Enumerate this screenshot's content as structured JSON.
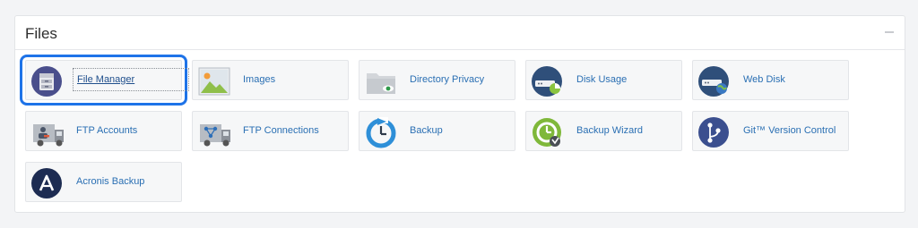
{
  "section": {
    "title": "Files",
    "collapse_icon": "minus-icon"
  },
  "items": [
    {
      "label": "File Manager",
      "icon": "file-manager-icon",
      "selected": true
    },
    {
      "label": "Images",
      "icon": "images-icon"
    },
    {
      "label": "Directory Privacy",
      "icon": "directory-privacy-icon"
    },
    {
      "label": "Disk Usage",
      "icon": "disk-usage-icon"
    },
    {
      "label": "Web Disk",
      "icon": "web-disk-icon"
    },
    {
      "label": "FTP Accounts",
      "icon": "ftp-accounts-icon"
    },
    {
      "label": "FTP Connections",
      "icon": "ftp-connections-icon"
    },
    {
      "label": "Backup",
      "icon": "backup-icon"
    },
    {
      "label": "Backup Wizard",
      "icon": "backup-wizard-icon"
    },
    {
      "label": "Git™ Version Control",
      "icon": "git-version-control-icon"
    },
    {
      "label": "Acronis Backup",
      "icon": "acronis-backup-icon"
    }
  ],
  "colors": {
    "accent": "#1e73e8",
    "link": "#2a6fb3"
  }
}
